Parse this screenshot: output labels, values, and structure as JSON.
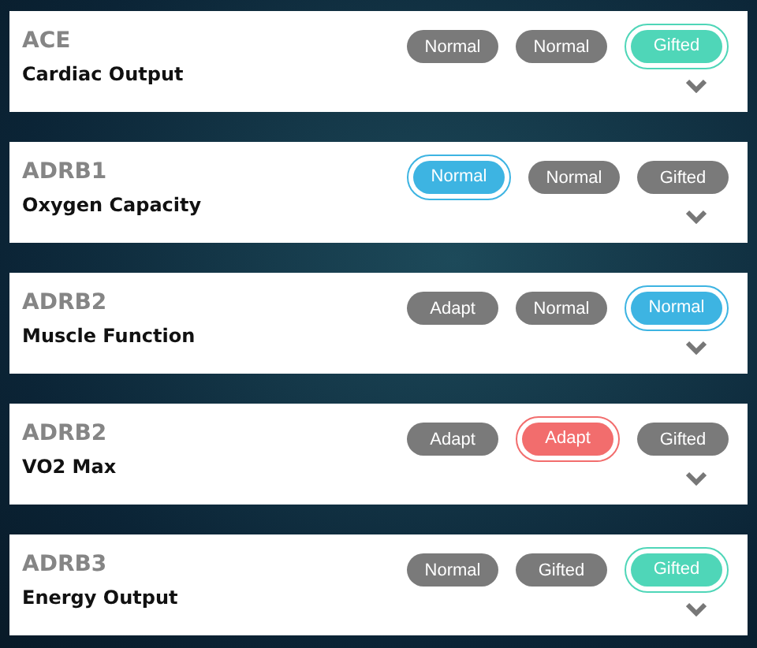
{
  "cards": [
    {
      "gene": "ACE",
      "trait": "Cardiac Output",
      "pills": [
        {
          "label": "Normal",
          "selected": false
        },
        {
          "label": "Normal",
          "selected": false
        },
        {
          "label": "Gifted",
          "selected": true,
          "color": "#4fd6b8"
        }
      ]
    },
    {
      "gene": "ADRB1",
      "trait": "Oxygen Capacity",
      "pills": [
        {
          "label": "Normal",
          "selected": true,
          "color": "#3db4e2"
        },
        {
          "label": "Normal",
          "selected": false
        },
        {
          "label": "Gifted",
          "selected": false
        }
      ]
    },
    {
      "gene": "ADRB2",
      "trait": "Muscle Function",
      "pills": [
        {
          "label": "Adapt",
          "selected": false
        },
        {
          "label": "Normal",
          "selected": false
        },
        {
          "label": "Normal",
          "selected": true,
          "color": "#3db4e2"
        }
      ]
    },
    {
      "gene": "ADRB2",
      "trait": "VO2 Max",
      "pills": [
        {
          "label": "Adapt",
          "selected": false
        },
        {
          "label": "Adapt",
          "selected": true,
          "color": "#f26d6d"
        },
        {
          "label": "Gifted",
          "selected": false
        }
      ]
    },
    {
      "gene": "ADRB3",
      "trait": "Energy Output",
      "pills": [
        {
          "label": "Normal",
          "selected": false
        },
        {
          "label": "Gifted",
          "selected": false
        },
        {
          "label": "Gifted",
          "selected": true,
          "color": "#4fd6b8"
        }
      ]
    }
  ]
}
